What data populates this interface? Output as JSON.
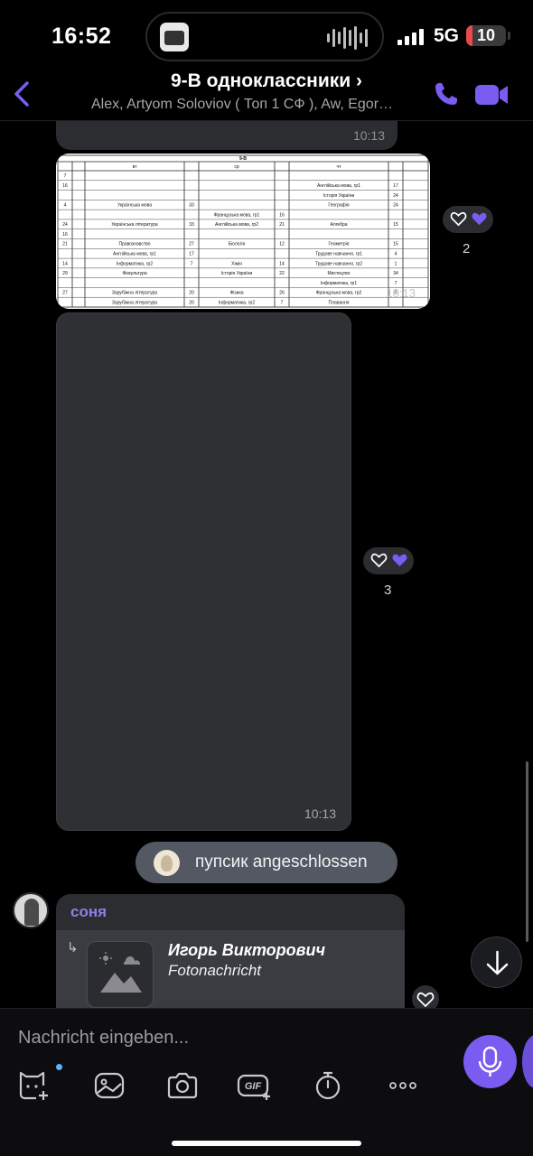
{
  "status_bar": {
    "time": "16:52",
    "network": "5G",
    "battery": "10",
    "battery_level": 0.1,
    "signal_bars": 4
  },
  "header": {
    "title": "9-В одноклассники ›",
    "subtitle": "Alex, Artyom Soloviov ( Топ 1 СФ ), Aw, Egor…"
  },
  "messages": {
    "first_bubble_time": "10:13",
    "schedule_image": {
      "title": "9-В",
      "columns": [
        "вт",
        "ср",
        "чт"
      ],
      "rows": [
        {
          "n": "7",
          "a": "",
          "ar": "",
          "b": "",
          "br": "",
          "c": "",
          "cr": ""
        },
        {
          "n": "16",
          "a": "",
          "ar": "",
          "b": "",
          "br": "",
          "c": "Англійська мова, гр1",
          "cr": "17"
        },
        {
          "n": "",
          "a": "",
          "ar": "",
          "b": "",
          "br": "",
          "c": "Історія України",
          "cr": "24"
        },
        {
          "n": "4",
          "a": "Українська мова",
          "ar": "33",
          "b": "",
          "br": "",
          "c": "Географія",
          "cr": "24"
        },
        {
          "n": "",
          "a": "",
          "ar": "",
          "b": "Французька мова, гр1",
          "br": "16",
          "c": "",
          "cr": ""
        },
        {
          "n": "24",
          "a": "Українська література",
          "ar": "33",
          "b": "Англійська мова, гр2",
          "br": "21",
          "c": "Алгебра",
          "cr": "15"
        },
        {
          "n": "16",
          "a": "",
          "ar": "",
          "b": "",
          "br": "",
          "c": "",
          "cr": ""
        },
        {
          "n": "21",
          "a": "Правознавство",
          "ar": "27",
          "b": "Біологія",
          "br": "12",
          "c": "Геометрія",
          "cr": "15"
        },
        {
          "n": "",
          "a": "Англійська мова, гр1",
          "ar": "17",
          "b": "",
          "br": "",
          "c": "Трудове навчання, гр1",
          "cr": "4"
        },
        {
          "n": "14",
          "a": "Інформатика, гр2",
          "ar": "7",
          "b": "Хімія",
          "br": "14",
          "c": "Трудове навчання, гр2",
          "cr": "1"
        },
        {
          "n": "29",
          "a": "Фізкультура",
          "ar": "",
          "b": "Історія України",
          "br": "22",
          "c": "Мистецтво",
          "cr": "34"
        },
        {
          "n": "",
          "a": "",
          "ar": "",
          "b": "",
          "br": "",
          "c": "Інформатика, гр1",
          "cr": "7"
        },
        {
          "n": "27",
          "a": "Зарубіжна література",
          "ar": "20",
          "b": "Фізика",
          "br": "26",
          "c": "Французька мова, гр2",
          "cr": "0"
        },
        {
          "n": "",
          "a": "Зарубіжна література",
          "ar": "20",
          "b": "Інформатика, гр2",
          "br": "7",
          "c": "Плавання",
          "cr": ""
        }
      ],
      "time": "10:13"
    },
    "schedule_reactions_count": "2",
    "photo_time": "10:13",
    "photo_reactions_count": "3",
    "system_event": "пупсик angeschlossen",
    "reply": {
      "sender": "соня",
      "quoted_author": "Игорь Викторович",
      "quoted_type": "Fotonachricht"
    }
  },
  "composer": {
    "placeholder": "Nachricht eingeben..."
  },
  "icons": {
    "back": "chevron-left-icon",
    "call": "phone-icon",
    "video": "video-camera-icon",
    "mic": "microphone-icon",
    "scroll_down": "arrow-down-icon",
    "tools": [
      "sticker-icon",
      "gallery-icon",
      "camera-icon",
      "gif-icon",
      "timer-icon",
      "more-icon"
    ]
  },
  "colors": {
    "accent": "#7b5cf0",
    "sender_name": "#8e7fe8",
    "bubble": "#2c2d31",
    "background": "#000000"
  }
}
